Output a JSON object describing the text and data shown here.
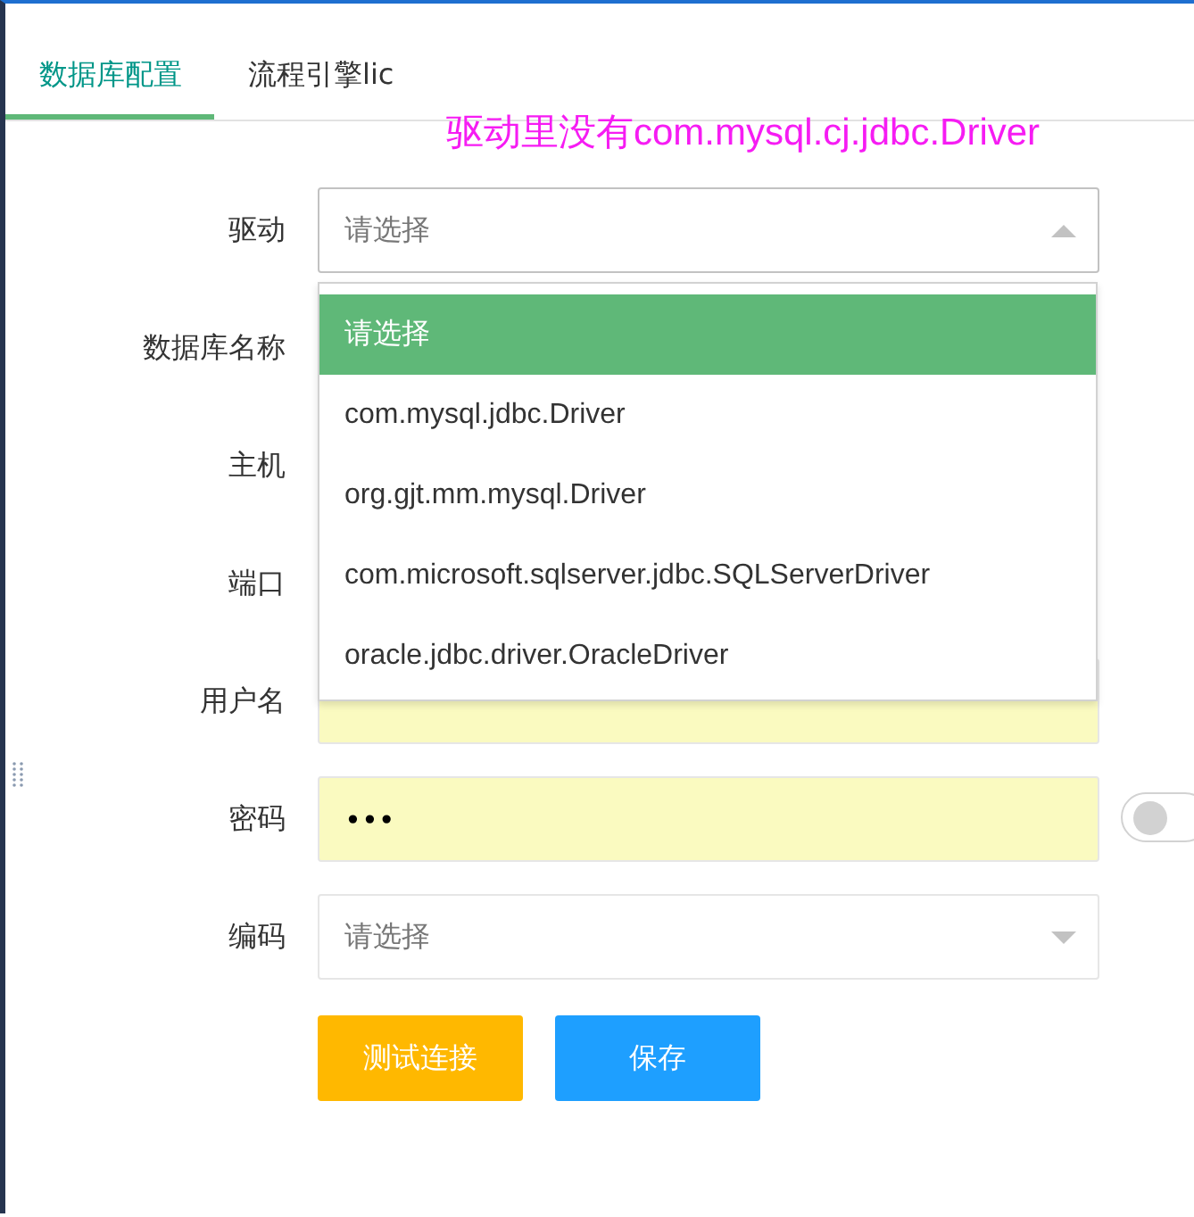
{
  "tabs": [
    {
      "label": "数据库配置",
      "selected": true
    },
    {
      "label": "流程引擎lic",
      "selected": false
    }
  ],
  "annotation": "驱动里没有com.mysql.cj.jdbc.Driver",
  "form": {
    "rows": [
      {
        "label": "驱动",
        "kind": "select",
        "placeholder": "请选择",
        "expanded": true,
        "options": [
          {
            "label": "请选择",
            "selected": true
          },
          {
            "label": "com.mysql.jdbc.Driver",
            "selected": false
          },
          {
            "label": "org.gjt.mm.mysql.Driver",
            "selected": false
          },
          {
            "label": "com.microsoft.sqlserver.jdbc.SQLServerDriver",
            "selected": false
          },
          {
            "label": "oracle.jdbc.driver.OracleDriver",
            "selected": false
          }
        ]
      },
      {
        "label": "数据库名称",
        "kind": "covered"
      },
      {
        "label": "主机",
        "kind": "covered"
      },
      {
        "label": "端口",
        "kind": "covered"
      },
      {
        "label": "用户名",
        "kind": "text",
        "autofilled": true
      },
      {
        "label": "密码",
        "kind": "password",
        "value": "•••",
        "autofilled": true,
        "switch": {
          "on": false
        }
      },
      {
        "label": "编码",
        "kind": "select",
        "placeholder": "请选择",
        "expanded": false
      }
    ]
  },
  "buttons": [
    {
      "label": "测试连接",
      "kind": "warning"
    },
    {
      "label": "保存",
      "kind": "primary"
    }
  ]
}
